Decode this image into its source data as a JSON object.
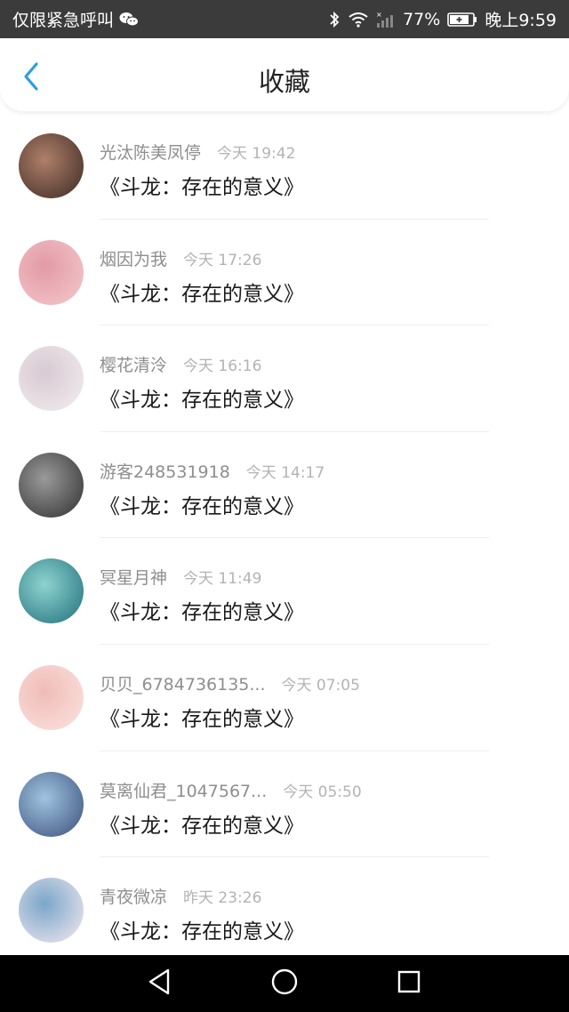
{
  "status_bar": {
    "left_text": "仅限紧急呼叫",
    "battery": "77%",
    "time": "晚上9:59",
    "icons": [
      "wechat-icon",
      "bluetooth-icon",
      "wifi-icon",
      "signal-icon",
      "battery-icon"
    ]
  },
  "header": {
    "title": "收藏",
    "back_icon": "chevron-left-icon",
    "accent_color": "#2d9ee0"
  },
  "items": [
    {
      "name": "光汰陈美凤停",
      "time": "今天 19:42",
      "content": "《斗龙：存在的意义》",
      "avatar_colors": [
        "#3a2a22",
        "#b07f6a"
      ]
    },
    {
      "name": "烟因为我",
      "time": "今天 17:26",
      "content": "《斗龙：存在的意义》",
      "avatar_colors": [
        "#f3c9cc",
        "#e39aa6"
      ]
    },
    {
      "name": "樱花清泠",
      "time": "今天 16:16",
      "content": "《斗龙：存在的意义》",
      "avatar_colors": [
        "#f1eef0",
        "#d9c9d2"
      ]
    },
    {
      "name": "游客248531918",
      "time": "今天 14:17",
      "content": "《斗龙：存在的意义》",
      "avatar_colors": [
        "#2f2f2f",
        "#9a9a9a"
      ]
    },
    {
      "name": "冥星月神",
      "time": "今天 11:49",
      "content": "《斗龙：存在的意义》",
      "avatar_colors": [
        "#1f6f7a",
        "#8fd3d0"
      ]
    },
    {
      "name": "贝贝_6784736135...",
      "time": "今天 07:05",
      "content": "《斗龙：存在的意义》",
      "avatar_colors": [
        "#fbe4df",
        "#f0bcb8"
      ]
    },
    {
      "name": "莫离仙君_1047567...",
      "time": "今天 05:50",
      "content": "《斗龙：存在的意义》",
      "avatar_colors": [
        "#3a4f7a",
        "#9fc4e0"
      ]
    },
    {
      "name": "青夜微凉",
      "time": "昨天 23:26",
      "content": "《斗龙：存在的意义》",
      "avatar_colors": [
        "#f6eaf0",
        "#7aa6c9"
      ]
    }
  ],
  "nav_bar": {
    "icons": [
      "back-triangle-icon",
      "home-circle-icon",
      "recents-square-icon"
    ]
  }
}
